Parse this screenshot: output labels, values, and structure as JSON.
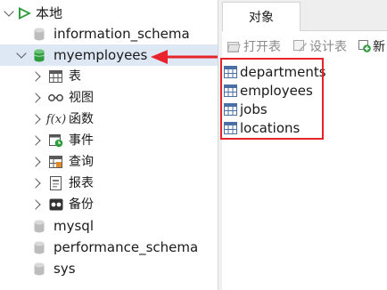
{
  "tree": {
    "connection": {
      "label": "本地",
      "icon": "connection-icon"
    },
    "databases_before": [
      {
        "label": "information_schema",
        "icon": "database-icon"
      }
    ],
    "selected_db": {
      "label": "myemployees",
      "icon": "database-open-icon",
      "accent": "#2e9b3c"
    },
    "db_children": [
      {
        "label": "表",
        "icon": "table-icon"
      },
      {
        "label": "视图",
        "icon": "view-icon"
      },
      {
        "label": "函数",
        "icon": "function-icon"
      },
      {
        "label": "事件",
        "icon": "event-icon"
      },
      {
        "label": "查询",
        "icon": "query-icon"
      },
      {
        "label": "报表",
        "icon": "report-icon"
      },
      {
        "label": "备份",
        "icon": "backup-icon"
      }
    ],
    "databases_after": [
      {
        "label": "mysql",
        "icon": "database-icon"
      },
      {
        "label": "performance_schema",
        "icon": "database-icon"
      },
      {
        "label": "sys",
        "icon": "database-icon"
      }
    ]
  },
  "tabs": [
    {
      "label": "对象"
    }
  ],
  "toolbar": {
    "open_table": "打开表",
    "design_table": "设计表",
    "new_table": "新"
  },
  "objects": [
    {
      "label": "departments",
      "icon": "table-icon"
    },
    {
      "label": "employees",
      "icon": "table-icon"
    },
    {
      "label": "jobs",
      "icon": "table-icon"
    },
    {
      "label": "locations",
      "icon": "table-icon"
    }
  ],
  "colors": {
    "selection": "#dde8f4",
    "annotation": "#e8232b",
    "database": "#bdbdbd",
    "table_icon": "#4a6fa5"
  }
}
